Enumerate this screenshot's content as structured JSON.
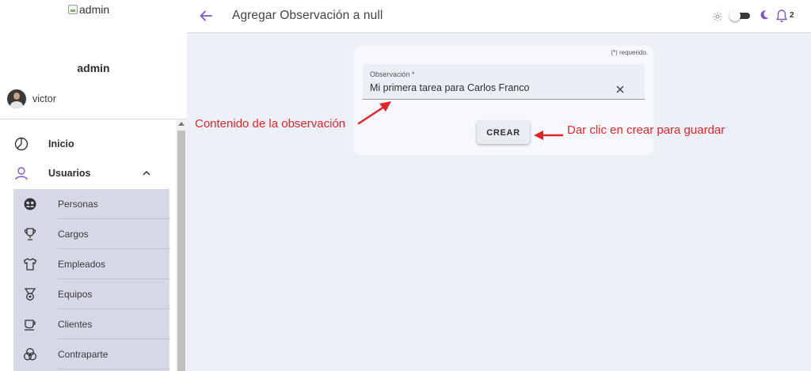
{
  "sidebar": {
    "brand_image_alt": "admin",
    "brand_name": "admin",
    "user_name": "victor",
    "menu": [
      {
        "label": "Inicio",
        "icon": "clock-icon"
      },
      {
        "label": "Usuarios",
        "icon": "user-icon",
        "expanded": true
      }
    ],
    "submenu": [
      {
        "label": "Personas",
        "icon": "people-circle-icon"
      },
      {
        "label": "Cargos",
        "icon": "trophy-icon"
      },
      {
        "label": "Empleados",
        "icon": "shirt-icon"
      },
      {
        "label": "Equipos",
        "icon": "medal-icon"
      },
      {
        "label": "Clientes",
        "icon": "cup-icon"
      },
      {
        "label": "Contraparte",
        "icon": "venn-icon"
      }
    ]
  },
  "header": {
    "title": "Agregar Observación a null",
    "notification_count": "2",
    "dark_mode_toggle": "off",
    "accent_color": "#7e57c2"
  },
  "form": {
    "required_note": "(*) requerido.",
    "observation_label": "Observación *",
    "observation_value": "Mi primera tarea para Carlos Franco",
    "submit_label": "CREAR"
  },
  "annotations": {
    "field_note": "Contenido de la observación",
    "button_note": "Dar clic en crear para guardar",
    "color": "#e0262a"
  }
}
